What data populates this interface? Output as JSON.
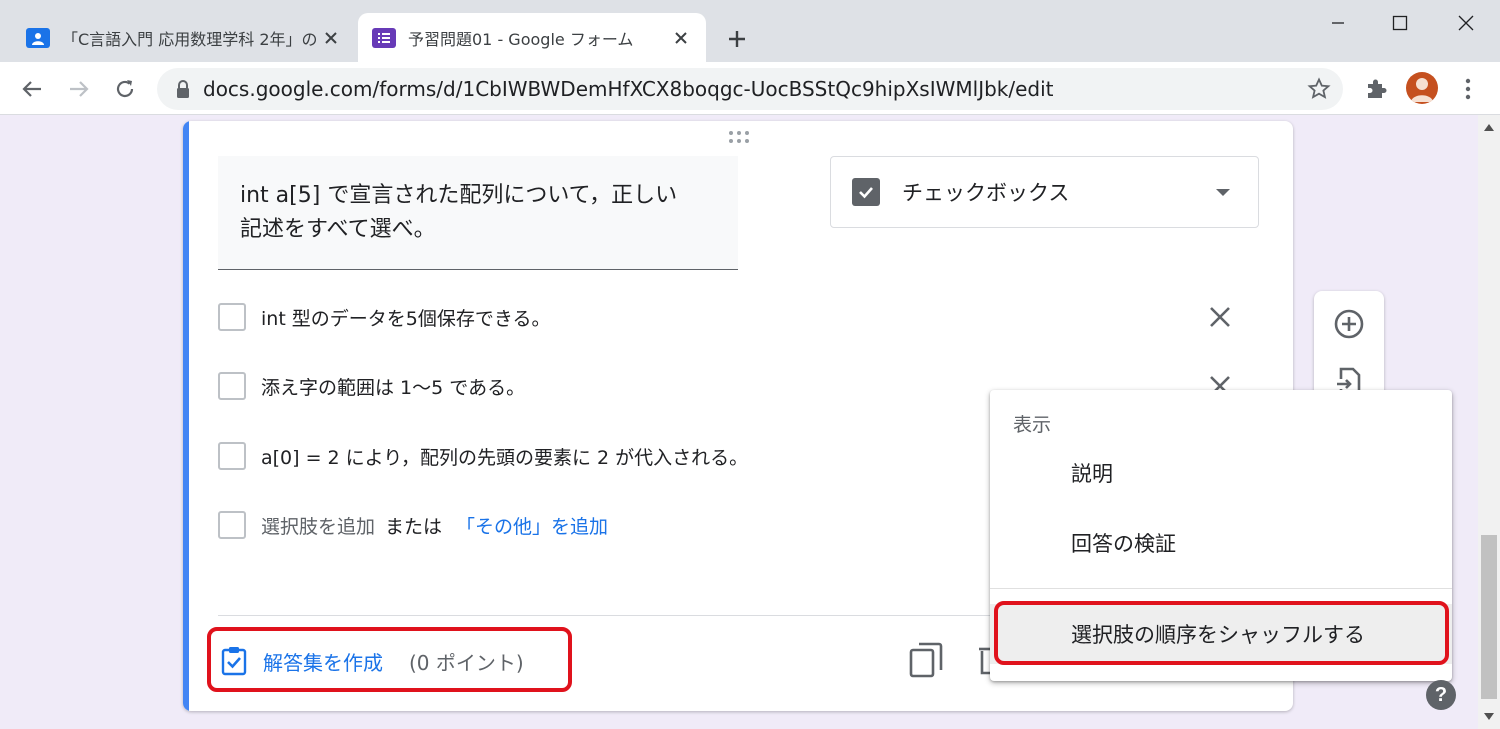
{
  "browser": {
    "tabs": [
      {
        "title": "「C言語入門 応用数理学科 2年」の",
        "active": false
      },
      {
        "title": "予習問題01 - Google フォーム",
        "active": true
      }
    ],
    "url": "docs.google.com/forms/d/1CbIWBWDemHfXCX8boqgc-UocBSStQc9hipXsIWMlJbk/edit"
  },
  "question": {
    "line1": "int a[5] で宣言された配列について，正しい",
    "line2": "記述をすべて選べ。",
    "type_label": "チェックボックス"
  },
  "options": [
    "int 型のデータを5個保存できる。",
    "添え字の範囲は 1〜5 である。",
    "a[0] = 2 により，配列の先頭の要素に 2 が代入される。"
  ],
  "add_option": {
    "label": "選択肢を追加",
    "or": "または",
    "other": "「その他」を追加"
  },
  "footer": {
    "answer_key": "解答集を作成",
    "points": "(0 ポイント)"
  },
  "menu": {
    "header": "表示",
    "items": [
      "説明",
      "回答の検証",
      "選択肢の順序をシャッフルする"
    ]
  },
  "help": "?",
  "colors": {
    "accent": "#4285f4",
    "link": "#1a73e8",
    "highlight": "#e0121c",
    "forms_purple": "#673ab7"
  }
}
